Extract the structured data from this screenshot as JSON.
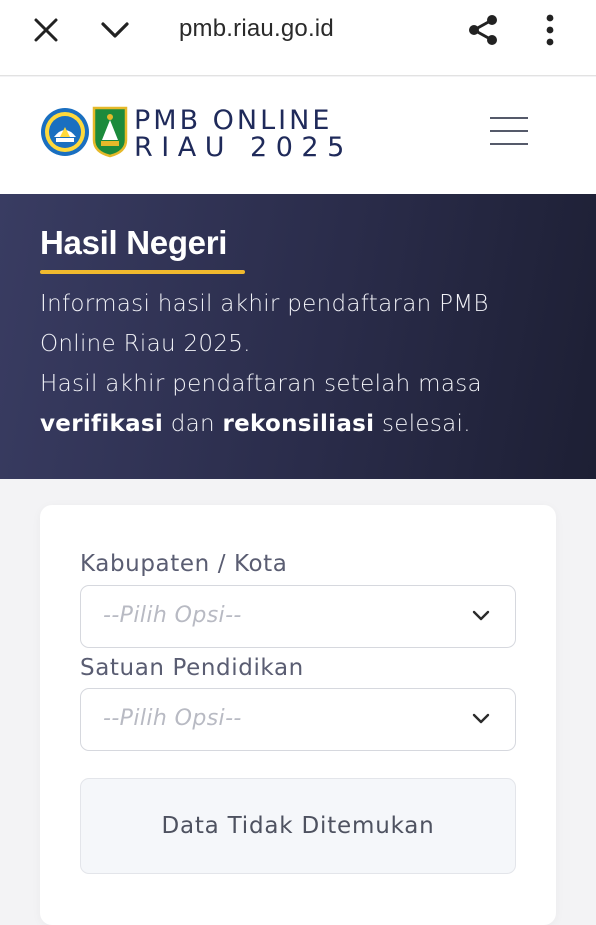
{
  "browser": {
    "url": "pmb.riau.go.id",
    "icons": [
      "close-icon",
      "chevron-down-icon",
      "share-icon",
      "more-vert-icon"
    ]
  },
  "header": {
    "brand_line1": "PMB ONLINE",
    "brand_line2": "RIAU 2025"
  },
  "hero": {
    "title": "Hasil Negeri",
    "line1": "Informasi hasil akhir pendaftaran PMB Online Riau 2025.",
    "line2_pre": "Hasil akhir pendaftaran setelah masa ",
    "line2_bold1": "verifikasi",
    "line2_mid": " dan ",
    "line2_bold2": "rekonsiliasi",
    "line2_post": " selesai."
  },
  "form": {
    "kabupaten_label": "Kabupaten / Kota",
    "kabupaten_value": "--Pilih Opsi--",
    "satuan_label": "Satuan Pendidikan",
    "satuan_value": "--Pilih Opsi--",
    "empty_message": "Data Tidak Ditemukan"
  },
  "colors": {
    "hero_bg": "#2a2c4a",
    "accent_underline": "#f0b92e",
    "brand_text": "#1f2a5a"
  }
}
